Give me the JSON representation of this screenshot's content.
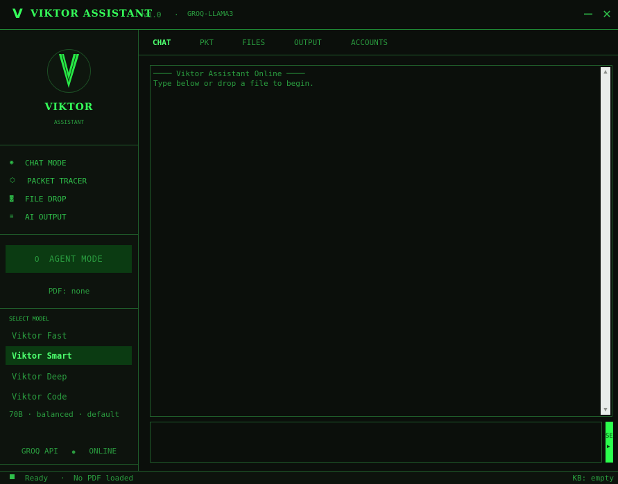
{
  "titlebar": {
    "logo": "V",
    "title": "VIKTOR ASSISTANT",
    "version": "v1.0",
    "separator": "·",
    "model_tag": "GROQ-LLAMA3",
    "minimize": "—",
    "close": "✕"
  },
  "brand": {
    "name": "VIKTOR",
    "subtitle": "ASSISTANT",
    "logo_icon": "v-logo-icon"
  },
  "nav": [
    {
      "icon": "◉",
      "label": "CHAT MODE"
    },
    {
      "icon": "⬡",
      "label": "PACKET TRACER"
    },
    {
      "icon": "◙",
      "label": "FILE DROP"
    },
    {
      "icon": "≡",
      "label": "AI OUTPUT"
    }
  ],
  "agent": {
    "icon": "O",
    "label": "AGENT MODE"
  },
  "pdf_status": "PDF: none",
  "models": {
    "heading": "SELECT MODEL",
    "items": [
      "Viktor Fast",
      "Viktor Smart",
      "Viktor Deep",
      "Viktor Code"
    ],
    "selected": "Viktor Smart",
    "description": "70B · balanced · default"
  },
  "api": {
    "name": "GROQ API",
    "dot": "●",
    "status": "ONLINE"
  },
  "tabs": [
    {
      "label": "CHAT",
      "active": true
    },
    {
      "label": "PKT",
      "active": false
    },
    {
      "label": "FILES",
      "active": false
    },
    {
      "label": "OUTPUT",
      "active": false
    },
    {
      "label": "ACCOUNTS",
      "active": false
    }
  ],
  "chat": {
    "header": "──── Viktor Assistant Online ────",
    "hint": "Type below or drop a file to begin.",
    "scroll_up": "▲",
    "scroll_down": "▼"
  },
  "input": {
    "value": "",
    "send_label": "SEND",
    "send_arrow": "▶"
  },
  "statusbar": {
    "ready": "Ready",
    "separator": "·",
    "pdf": "No PDF loaded",
    "kb": "KB: empty"
  },
  "colors": {
    "accent": "#35ff5a",
    "text": "#2fbf4a",
    "dim": "#2a9c3f",
    "background": "#0b0f0b",
    "active_bg": "#0b3b12"
  }
}
